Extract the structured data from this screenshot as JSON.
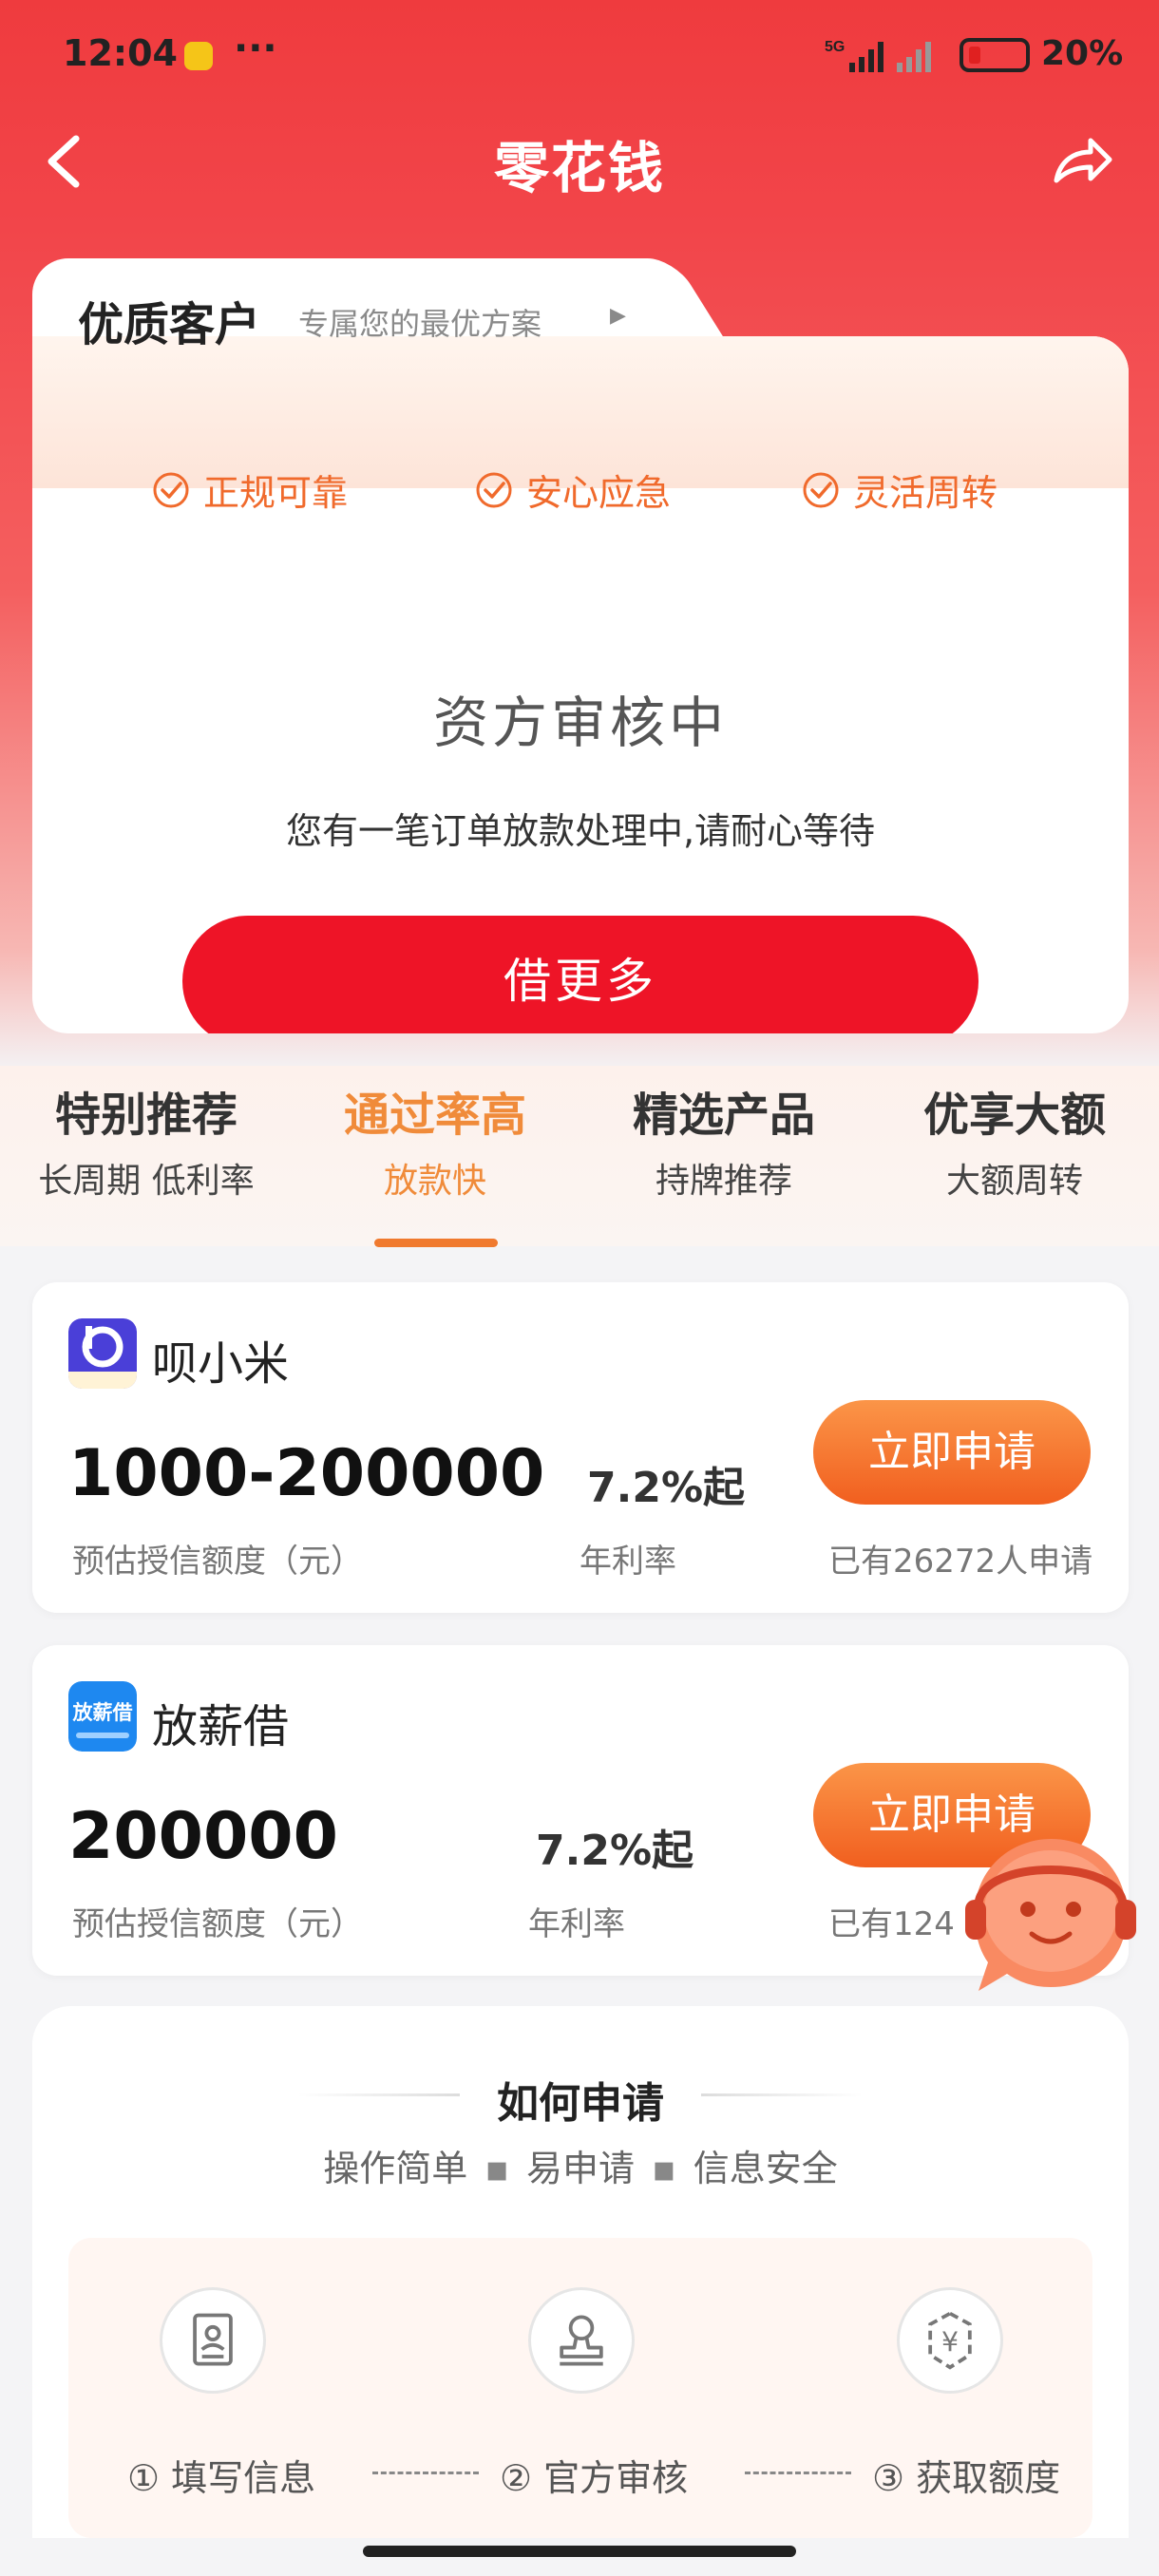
{
  "status_bar": {
    "time": "12:04",
    "more": "···",
    "battery_pct": "20%",
    "network": "5G"
  },
  "nav": {
    "title": "零花钱",
    "back_icon": "chevron-left-icon",
    "share_icon": "share-icon"
  },
  "vip_card": {
    "title": "优质客户",
    "subtitle": "专属您的最优方案",
    "subtitle_arrow": "▶",
    "features": [
      "正规可靠",
      "安心应急",
      "灵活周转"
    ],
    "status_title": "资方审核中",
    "status_desc": "您有一笔订单放款处理中,请耐心等待",
    "cta_label": "借更多"
  },
  "categories": [
    {
      "title": "特别推荐",
      "subtitle": "长周期 低利率",
      "active": false
    },
    {
      "title": "通过率高",
      "subtitle": "放款快",
      "active": true
    },
    {
      "title": "精选产品",
      "subtitle": "持牌推荐",
      "active": false
    },
    {
      "title": "优享大额",
      "subtitle": "大额周转",
      "active": false
    }
  ],
  "products": [
    {
      "name": "呗小米",
      "logo_text": "呗小米",
      "amount": "1000-200000",
      "amount_label": "预估授信额度（元）",
      "rate": "7.2%起",
      "rate_label": "年利率",
      "apply_label": "立即申请",
      "count": "已有26272人申请"
    },
    {
      "name": "放薪借",
      "logo_text": "放薪借",
      "amount": "200000",
      "amount_label": "预估授信额度（元）",
      "rate": "7.2%起",
      "rate_label": "年利率",
      "apply_label": "立即申请",
      "count": "已有124"
    }
  ],
  "howto": {
    "title": "如何申请",
    "tags": [
      "操作简单",
      "易申请",
      "信息安全"
    ],
    "tag_sep": "▪",
    "steps": [
      {
        "label": "① 填写信息",
        "icon": "form-icon"
      },
      {
        "label": "② 官方审核",
        "icon": "stamp-icon"
      },
      {
        "label": "③ 获取额度",
        "icon": "yen-icon"
      }
    ]
  },
  "colors": {
    "brand_red": "#ee1427",
    "accent_orange": "#f15f1f",
    "active_tab": "#f08b3a"
  }
}
